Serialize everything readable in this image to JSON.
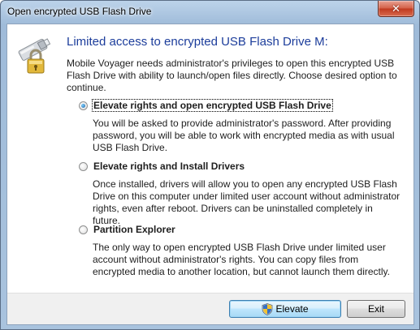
{
  "window": {
    "title": "Open encrypted USB Flash Drive",
    "close_glyph": "✕"
  },
  "icons": {
    "app": "usb-lock-icon",
    "close": "close-icon",
    "shield": "uac-shield-icon"
  },
  "content": {
    "header": "Limited access to encrypted USB Flash Drive M:",
    "intro": "Mobile Voyager needs administrator's privileges to open this encrypted USB Flash Drive with ability to launch/open files directly. Choose desired option to continue."
  },
  "options": [
    {
      "label": "Elevate rights and open encrypted USB Flash Drive",
      "description": "You will be asked to provide administrator's password. After providing password, you will be able to work with encrypted media as with usual USB Flash Drive.",
      "selected": true
    },
    {
      "label": "Elevate rights and Install Drivers",
      "description": "Once installed, drivers will allow you to open any encrypted USB Flash Drive on this computer under limited user account without administrator rights, even after reboot. Drivers can be uninstalled completely in future.",
      "selected": false
    },
    {
      "label": "Partition Explorer",
      "description": "The only way to open encrypted USB Flash Drive under limited user account without administrator's rights. You can copy files from encrypted media to another location, but cannot launch them directly.",
      "selected": false
    }
  ],
  "buttons": {
    "elevate": "Elevate",
    "exit": "Exit"
  },
  "colors": {
    "header_text": "#1c3d9b",
    "titlebar": "#a9c3de",
    "close_button": "#c0391f",
    "default_button_border": "#3c7fb1"
  }
}
